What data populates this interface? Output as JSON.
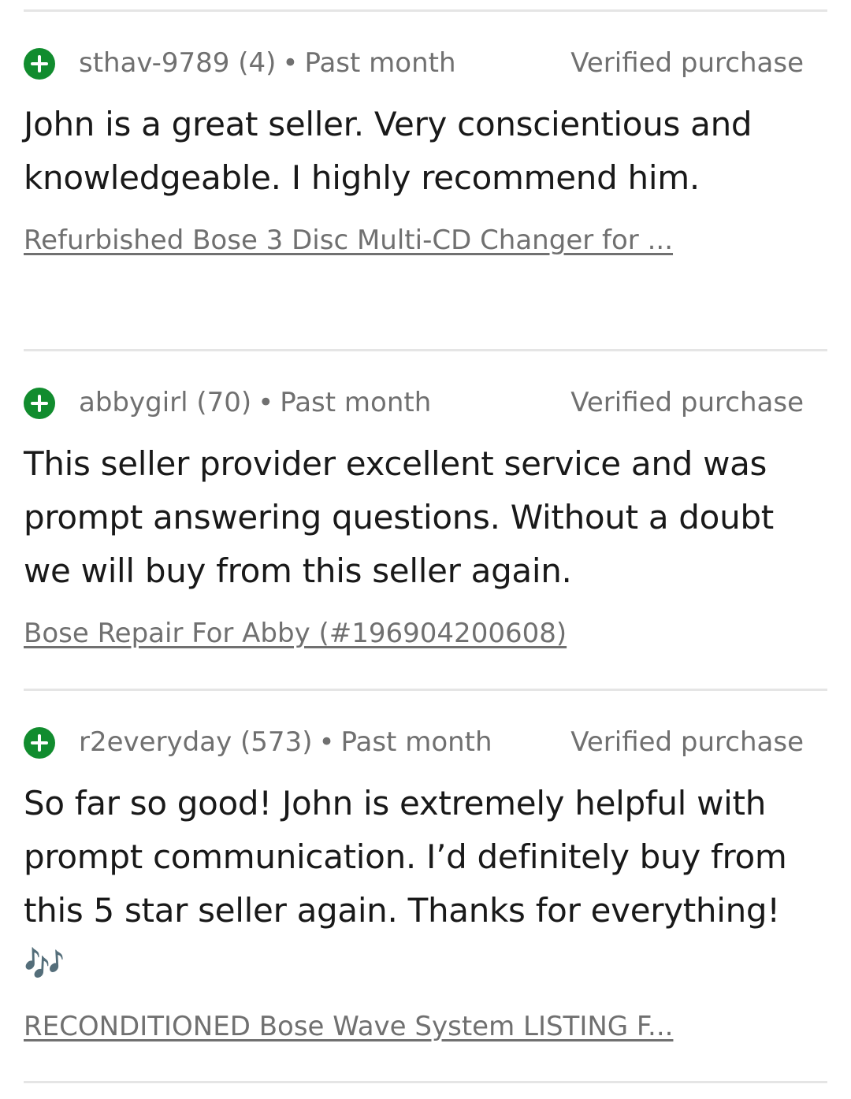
{
  "reviews": [
    {
      "username": "sthav-9789",
      "score": "(4)",
      "separator": "•",
      "time": "Past month",
      "badge": "Verified purchase",
      "text": "John is a great seller. Very conscientious and knowledgeable. I highly recommend him.",
      "item": "Refurbished Bose 3 Disc Multi-CD Changer for ..."
    },
    {
      "username": "abbygirl",
      "score": "(70)",
      "separator": "•",
      "time": "Past month",
      "badge": "Verified purchase",
      "text": "This seller provider excellent service and was prompt answering questions. Without a doubt we will buy from this seller again.",
      "item": "Bose Repair For Abby (#196904200608)"
    },
    {
      "username": "r2everyday",
      "score": "(573)",
      "separator": "•",
      "time": "Past month",
      "badge": "Verified purchase",
      "text": "So far so good! John is extremely helpful with prompt communication. I’d definitely buy from this 5 star seller again. Thanks for everything! 🎶",
      "item": "RECONDITIONED Bose Wave System LISTING F..."
    }
  ],
  "colors": {
    "positive": "#118c2e",
    "muted": "#707070",
    "text": "#191919",
    "divider": "#e5e5e5"
  },
  "icons": {
    "feedback_type": "plus-circle-icon"
  }
}
